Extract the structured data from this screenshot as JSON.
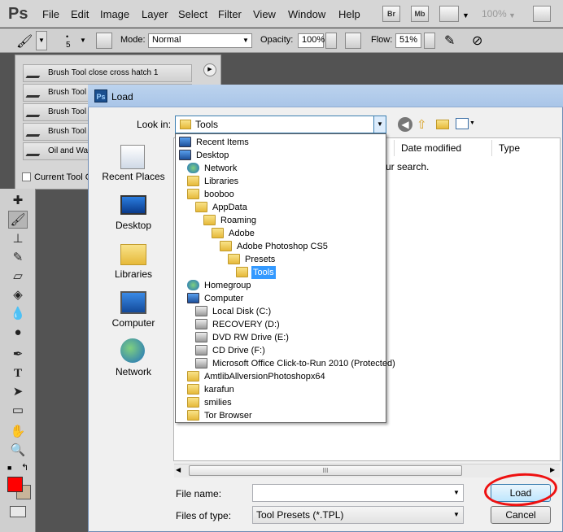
{
  "app": {
    "logo": "Ps"
  },
  "menubar": {
    "items": [
      "File",
      "Edit",
      "Image",
      "Layer",
      "Select",
      "Filter",
      "View",
      "Window",
      "Help"
    ],
    "btn_bridge": "Br",
    "btn_minibridge": "Mb",
    "zoom": "100%"
  },
  "options": {
    "brush_size": "5",
    "mode_label": "Mode:",
    "mode_value": "Normal",
    "opacity_label": "Opacity:",
    "opacity_value": "100%",
    "flow_label": "Flow:",
    "flow_value": "51%"
  },
  "preset_panel": {
    "items": [
      "Brush Tool close cross hatch 1",
      "Brush Tool",
      "Brush Tool",
      "Brush Tool",
      "Oil and Wa"
    ],
    "current_tool_label": "Current Tool O"
  },
  "dialog": {
    "title": "Load",
    "look_in_label": "Look in:",
    "look_in_value": "Tools",
    "places": [
      "Recent Places",
      "Desktop",
      "Libraries",
      "Computer",
      "Network"
    ],
    "columns": [
      "Date modified",
      "Type"
    ],
    "empty_message": "ur search.",
    "file_name_label": "File name:",
    "file_name_value": "",
    "files_of_type_label": "Files of type:",
    "files_of_type_value": "Tool Presets (*.TPL)",
    "load_button": "Load",
    "cancel_button": "Cancel",
    "scroll_grip": "III"
  },
  "dropdown": {
    "items": [
      {
        "label": "Recent Items",
        "icon": "recent-items-icon"
      },
      {
        "label": "Desktop",
        "icon": "desktop-icon"
      },
      {
        "label": "Network",
        "icon": "network-icon"
      },
      {
        "label": "Libraries",
        "icon": "libraries-icon"
      },
      {
        "label": "booboo",
        "icon": "user-folder-icon"
      },
      {
        "label": "AppData",
        "icon": "folder-icon"
      },
      {
        "label": "Roaming",
        "icon": "folder-icon"
      },
      {
        "label": "Adobe",
        "icon": "folder-icon"
      },
      {
        "label": "Adobe Photoshop CS5",
        "icon": "folder-icon"
      },
      {
        "label": "Presets",
        "icon": "folder-icon"
      },
      {
        "label": "Tools",
        "icon": "folder-icon",
        "selected": true
      },
      {
        "label": "Homegroup",
        "icon": "homegroup-icon"
      },
      {
        "label": "Computer",
        "icon": "computer-icon"
      },
      {
        "label": "Local Disk (C:)",
        "icon": "local-disk-icon"
      },
      {
        "label": "RECOVERY (D:)",
        "icon": "drive-icon"
      },
      {
        "label": "DVD RW Drive (E:)",
        "icon": "dvd-drive-icon"
      },
      {
        "label": "CD Drive (F:)",
        "icon": "cd-drive-icon"
      },
      {
        "label": "Microsoft Office Click-to-Run 2010 (Protected)",
        "icon": "drive-icon"
      },
      {
        "label": "AmtlibAllversionPhotoshopx64",
        "icon": "folder-icon"
      },
      {
        "label": "karafun",
        "icon": "folder-icon"
      },
      {
        "label": "smilies",
        "icon": "folder-icon"
      },
      {
        "label": "Tor Browser",
        "icon": "folder-icon"
      }
    ]
  },
  "colors": {
    "foreground": "#ff0000",
    "background": "#c8b49a",
    "highlight": "#3399ff",
    "annotation": "#ee1111"
  }
}
